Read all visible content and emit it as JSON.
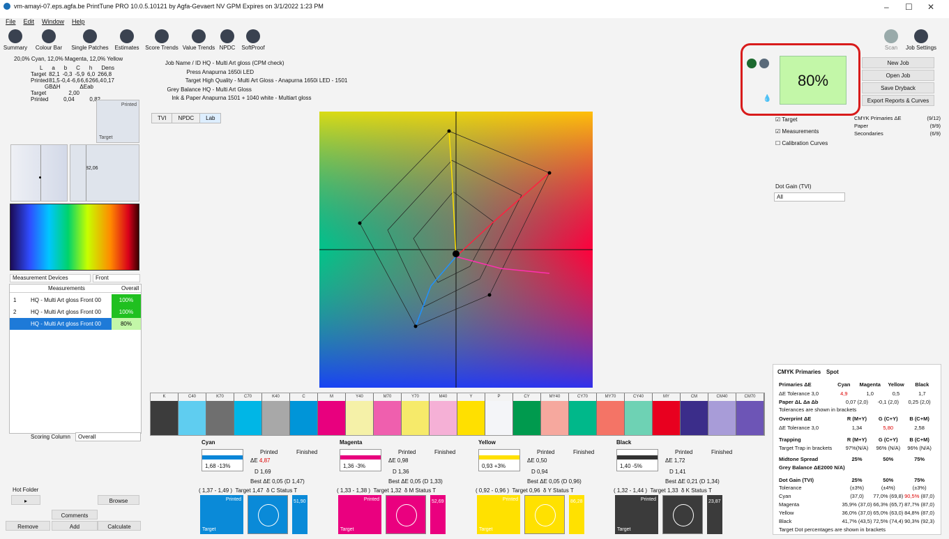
{
  "title": "vm-amayi-07.eps.agfa.be PrintTune PRO 10.0.5.10121 by Agfa-Gevaert NV GPM Expires on 3/1/2022 1:23 PM",
  "menu": [
    "File",
    "Edit",
    "Window",
    "Help"
  ],
  "toolbar": [
    "Summary",
    "Colour Bar",
    "Single Patches",
    "Estimates",
    "Score Trends",
    "Value Trends",
    "NPDC",
    "SoftProof"
  ],
  "toolbar_right": [
    "Scan",
    "Job Settings"
  ],
  "summary": {
    "line": "20,0% Cyan, 12,0% Magenta, 12,0% Yellow",
    "head": [
      "L",
      "a",
      "b",
      "C",
      "h",
      "Dens"
    ],
    "target": [
      "Target",
      "82,1",
      "-0,3",
      "-5,9",
      "6,0",
      "266,8"
    ],
    "printed": [
      "Printed",
      "81,5",
      "-0,4",
      "-6,6",
      "6,6",
      "266,4",
      "0,17"
    ],
    "gb": [
      "GBΔH",
      "ΔEab"
    ],
    "t2": [
      "Target",
      "2,00"
    ],
    "p2": [
      "Printed",
      "0,04",
      "0,82"
    ]
  },
  "job": {
    "name_label": "Job Name / ID",
    "name": "HQ - Multi Art gloss (CPM check)",
    "press_label": "Press",
    "press": "Anapurna 1650i LED",
    "target_label": "Target",
    "target": "High Quality - Multi Art Gloss - Anapurna 1650i LED - 1501",
    "grey_label": "Grey Balance",
    "grey": "HQ - Multi Art Gloss",
    "ink_label": "Ink & Paper",
    "ink": "Anapurna 1501 + 1040 white - Multiart gloss"
  },
  "tabs": [
    "TVI",
    "NPDC",
    "Lab"
  ],
  "small_labels": {
    "printed": "Printed",
    "target": "Target",
    "v8206": "82,06"
  },
  "score": "80%",
  "buttons": [
    "New Job",
    "Open Job",
    "Save Dryback",
    "Export Reports & Curves"
  ],
  "checks": [
    "Target",
    "Measurements",
    "Calibration Curves"
  ],
  "primaries": [
    [
      "CMYK Primaries ΔE",
      "(9/12)"
    ],
    [
      "Paper",
      "(9/9)"
    ],
    [
      "Secondaries",
      "(6/9)"
    ]
  ],
  "dotgain_label": "Dot Gain (TVI)",
  "dotgain_value": "All",
  "devices": {
    "label": "Measurement Devices",
    "side": "Front",
    "col1": "Measurements",
    "col2": "Overall",
    "rows": [
      [
        "1",
        "HQ - Multi Art gloss Front 00",
        "100%"
      ],
      [
        "2",
        "HQ - Multi Art gloss Front 00",
        "100%"
      ],
      [
        "",
        "HQ - Multi Art gloss Front 00",
        "80%"
      ]
    ]
  },
  "scoring": {
    "label": "Scoring Column",
    "value": "Overall"
  },
  "hotfolder": "Hot Folder",
  "browse": "Browse",
  "comments": "Comments",
  "remove": "Remove",
  "add": "Add",
  "calculate": "Calculate",
  "patches": [
    [
      "K",
      "#3c3c3c"
    ],
    [
      "C40",
      "#5fcdf0"
    ],
    [
      "K70",
      "#6f6f6f"
    ],
    [
      "C70",
      "#00b6e6"
    ],
    [
      "K40",
      "#a8a8a8"
    ],
    [
      "C",
      "#0095d8"
    ],
    [
      "M",
      "#e8007e"
    ],
    [
      "Y40",
      "#f5f1a8"
    ],
    [
      "M70",
      "#ef5fae"
    ],
    [
      "Y70",
      "#f6ea6a"
    ],
    [
      "M40",
      "#f5b0d6"
    ],
    [
      "Y",
      "#ffe000"
    ],
    [
      "P",
      "#f4f5f8"
    ],
    [
      "CY",
      "#009a4e"
    ],
    [
      "MY40",
      "#f6a89e"
    ],
    [
      "CY70",
      "#00b88a"
    ],
    [
      "MY70",
      "#f47466"
    ],
    [
      "CY40",
      "#6ed2b4"
    ],
    [
      "MY",
      "#e8001f"
    ],
    [
      "CM",
      "#3b2d8a"
    ],
    [
      "CM40",
      "#a89cd8"
    ],
    [
      "CM70",
      "#6d55b6"
    ]
  ],
  "colors": [
    {
      "name": "Cyan",
      "bar": "#0a86d8",
      "tvi": "1,68 -13%",
      "de": "4,87",
      "d": "1,69",
      "best": "Best ΔE 0,05 (D 1,47)",
      "range": "( 1,37 - 1,49 )",
      "tgt": "Target 1,47",
      "st": "δ C Status T",
      "v": "51,90",
      "sw": "#0a8ad8"
    },
    {
      "name": "Magenta",
      "bar": "#e8007e",
      "tvi": "1,36 -3%",
      "de": "0,98",
      "d": "1,36",
      "best": "Best ΔE 0,05 (D 1,33)",
      "range": "( 1,33 - 1,38 )",
      "tgt": "Target 1,32",
      "st": "δ M Status T",
      "v": "52,69",
      "sw": "#ea007f"
    },
    {
      "name": "Yellow",
      "bar": "#ffe000",
      "tvi": "0,93 +3%",
      "de": "0,50",
      "d": "0,94",
      "best": "Best ΔE 0,05 (D 0,96)",
      "range": "( 0,92 - 0,96 )",
      "tgt": "Target 0,96",
      "st": "δ Y Status T",
      "v": "86,28",
      "sw": "#ffe100"
    },
    {
      "name": "Black",
      "bar": "#333333",
      "tvi": "1,40 -5%",
      "de": "1,72",
      "d": "1,41",
      "best": "Best ΔE 0,21 (D 1,34)",
      "range": "( 1,32 - 1,44 )",
      "tgt": "Target 1,33",
      "st": "δ K Status T",
      "v": "23,87",
      "sw": "#3b3b3b"
    }
  ],
  "printed_lbl": "Printed",
  "finished_lbl": "Finished",
  "cmyk": {
    "tabs": [
      "CMYK Primaries",
      "Spot"
    ],
    "h1": [
      "Primaries ΔE",
      "Cyan",
      "Magenta",
      "Yellow",
      "Black"
    ],
    "tol": [
      "ΔE Tolerance",
      "3,0",
      "4,9",
      "1,0",
      "0,5",
      "1,7"
    ],
    "paper": [
      "Paper ΔL Δa Δb",
      "0,07",
      "(2,0)",
      "-0,1",
      "(2,0)",
      "0,25",
      "(2,0)"
    ],
    "note": "Tolerances are shown in brackets",
    "h2": [
      "Overprint ΔE",
      "R (M+Y)",
      "G (C+Y)",
      "B (C+M)"
    ],
    "tol2": [
      "ΔE Tolerance 3,0",
      "1,34",
      "5,80",
      "2,58"
    ],
    "h3": [
      "Trapping",
      "R (M+Y)",
      "G (C+Y)",
      "B (C+M)"
    ],
    "trap": [
      "Target Trap in brackets",
      "97%(N/A)",
      "96% (N/A)",
      "96% (N/A)"
    ],
    "h4": [
      "Midtone Spread",
      "25%",
      "50%",
      "75%"
    ],
    "h4b": "Grey Balance ΔE2000 N/A)",
    "h5": [
      "Dot Gain (TVI)",
      "25%",
      "50%",
      "75%"
    ],
    "tol5": [
      "Tolerance",
      "(±3%)",
      "(±4%)",
      "(±3%)"
    ],
    "dg": [
      [
        "Cyan",
        "(37,0)",
        "77,0%",
        "(69,8)",
        "90,5%",
        "(87,0)"
      ],
      [
        "Magenta",
        "35,9%",
        "(37,0)",
        "66,3%",
        "(65,7)",
        "87,7%",
        "(87,0)"
      ],
      [
        "Yellow",
        "36,0%",
        "(37,0)",
        "65,0%",
        "(63,0)",
        "84,8%",
        "(87,0)"
      ],
      [
        "Black",
        "41,7%",
        "(43,5)",
        "72,5%",
        "(74,4)",
        "90,3%",
        "(92,3)"
      ]
    ],
    "foot": "Target Dot percentages are shown in brackets"
  }
}
